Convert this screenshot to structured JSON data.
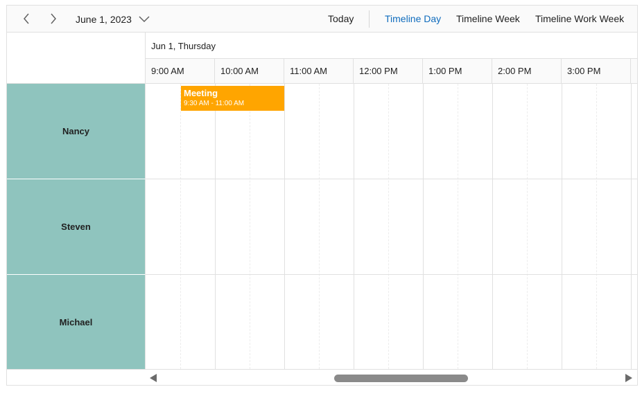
{
  "toolbar": {
    "current_date": "June 1, 2023",
    "today_label": "Today",
    "views": [
      "Timeline Day",
      "Timeline Week",
      "Timeline Work Week"
    ],
    "active_view": "Timeline Day",
    "active_color": "#0f6cbd"
  },
  "header": {
    "date_label": "Jun 1, Thursday",
    "times": [
      "9:00 AM",
      "10:00 AM",
      "11:00 AM",
      "12:00 PM",
      "1:00 PM",
      "2:00 PM",
      "3:00 PM"
    ]
  },
  "resources": [
    {
      "name": "Nancy",
      "color": "#8fc4be"
    },
    {
      "name": "Steven",
      "color": "#8fc4be"
    },
    {
      "name": "Michael",
      "color": "#8fc4be"
    }
  ],
  "appointment": {
    "subject": "Meeting",
    "time": "9:30 AM - 11:00 AM",
    "resource": "Nancy",
    "color": "#ffa500"
  },
  "icons": {
    "prev": "chevron-left-icon",
    "next": "chevron-right-icon",
    "date_dropdown": "chevron-down-icon",
    "scroll_left": "triangle-left-icon",
    "scroll_right": "triangle-right-icon"
  }
}
